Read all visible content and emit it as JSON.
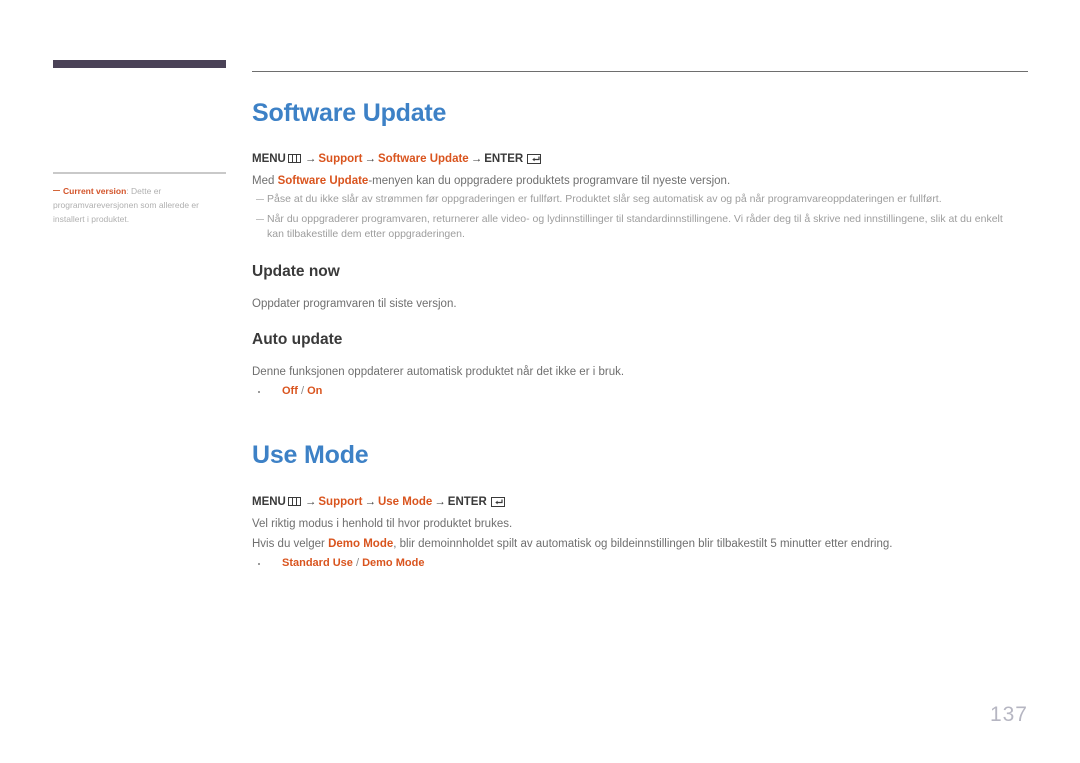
{
  "sidebar": {
    "note": {
      "term": "Current version",
      "separator": ": ",
      "text": "Dette er programvareversjonen som allerede er installert i produktet."
    }
  },
  "colors": {
    "heading_blue": "#3d81c6",
    "accent_orange": "#d9541e",
    "brand_bar_purple": "#4a4257",
    "body_gray": "#6f6f6f",
    "note_gray": "#9d9d9d",
    "page_number_gray": "#b6b6c2"
  },
  "sections": {
    "software_update": {
      "title": "Software Update",
      "breadcrumb": {
        "menu_label": "MENU",
        "menu_icon": "menu-grid-icon",
        "arrow": "→",
        "item1": "Support",
        "item2": "Software Update",
        "enter_label": "ENTER",
        "enter_icon": "enter-return-icon"
      },
      "intro_prefix": "Med ",
      "intro_accent": "Software Update",
      "intro_suffix": "-menyen kan du oppgradere produktets programvare til nyeste versjon.",
      "notes": [
        "Påse at du ikke slår av strømmen før oppgraderingen er fullført. Produktet slår seg automatisk av og på når programvareoppdateringen er fullført.",
        "Når du oppgraderer programvaren, returnerer alle video- og lydinnstillinger til standardinnstillingene. Vi råder deg til å skrive ned innstillingene, slik at du enkelt kan tilbakestille dem etter oppgraderingen."
      ],
      "subsections": [
        {
          "title": "Update now",
          "body": "Oppdater programvaren til siste versjon."
        },
        {
          "title": "Auto update",
          "body": "Denne funksjonen oppdaterer automatisk produktet når det ikke er i bruk.",
          "options": {
            "first": "Off",
            "sep": " / ",
            "second": "On"
          }
        }
      ]
    },
    "use_mode": {
      "title": "Use Mode",
      "breadcrumb": {
        "menu_label": "MENU",
        "menu_icon": "menu-grid-icon",
        "arrow": "→",
        "item1": "Support",
        "item2": "Use Mode",
        "enter_label": "ENTER",
        "enter_icon": "enter-return-icon"
      },
      "body1": "Vel riktig modus i henhold til hvor produktet brukes.",
      "body2_prefix": "Hvis du velger ",
      "body2_accent": "Demo Mode",
      "body2_suffix": ", blir demoinnholdet spilt av automatisk og bildeinnstillingen blir tilbakestilt 5 minutter etter endring.",
      "options": {
        "first": "Standard Use",
        "sep": " / ",
        "second": "Demo Mode"
      }
    }
  },
  "footer": {
    "page_number": "137"
  }
}
